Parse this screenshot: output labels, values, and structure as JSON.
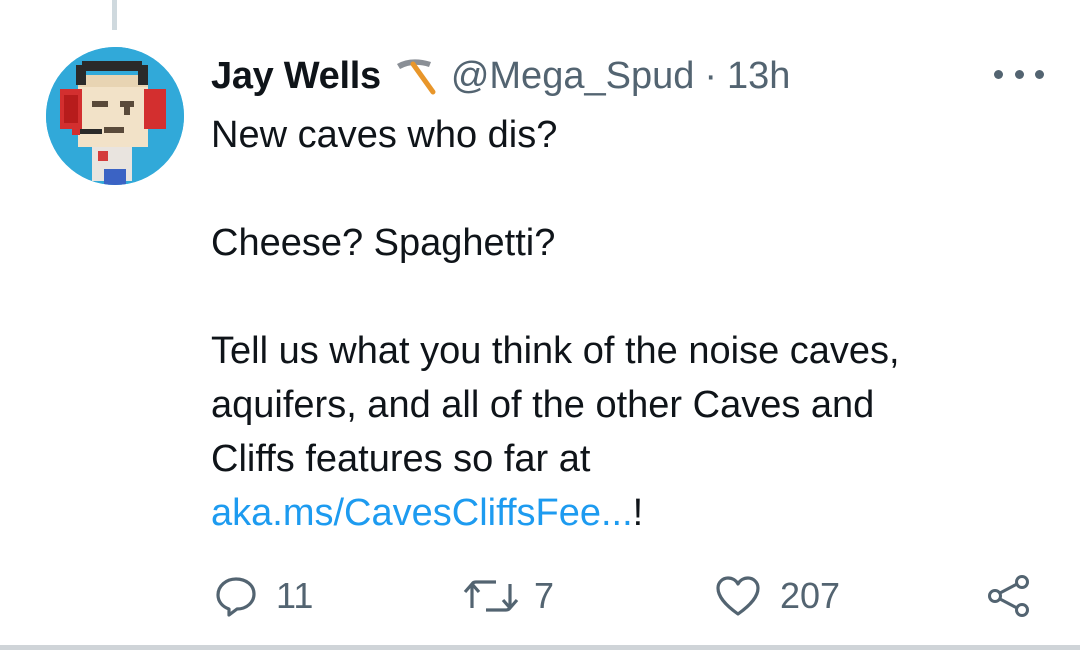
{
  "tweet": {
    "author_name": "Jay Wells",
    "author_badge_icon": "pickaxe-icon",
    "handle": "@Mega_Spud",
    "separator": "·",
    "time": "13h",
    "text_line1": "New caves who dis?",
    "text_line2": "Cheese? Spaghetti?",
    "text_line3": "Tell us what you think of the noise caves,",
    "text_line4": "aquifers, and all of the other Caves and",
    "text_line5": "Cliffs features so far at",
    "link_text": "aka.ms/CavesCliffsFee...",
    "link_suffix": "!"
  },
  "actions": {
    "reply_count": "11",
    "retweet_count": "7",
    "like_count": "207"
  },
  "colors": {
    "link": "#1d9bf0",
    "muted": "#536471",
    "avatar_bg": "#31a9d9"
  }
}
